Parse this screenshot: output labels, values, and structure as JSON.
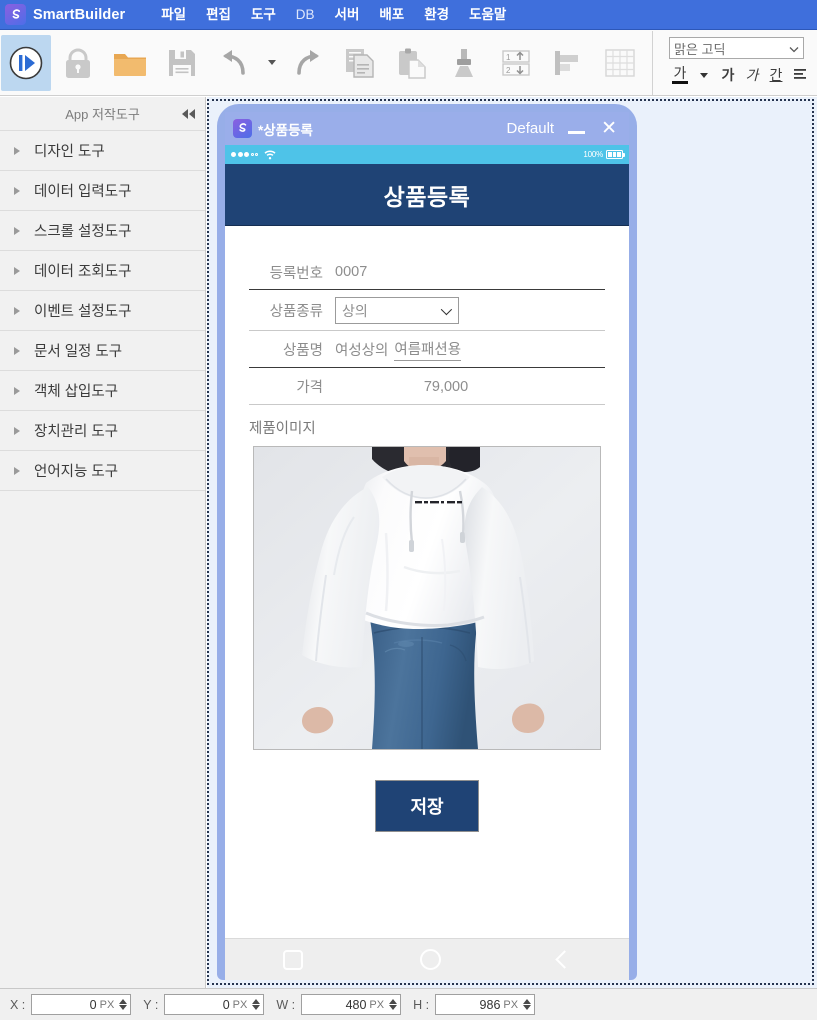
{
  "app": {
    "brand": "SmartBuilder",
    "logo_icon": "smartbuilder-s-logo-icon",
    "accent_color": "#3f6fdc",
    "canvas_color": "#eaf1fb",
    "device_frame_color": "#97aee8"
  },
  "menubar": {
    "items": [
      {
        "label": "파일",
        "name": "menu-file"
      },
      {
        "label": "편집",
        "name": "menu-edit"
      },
      {
        "label": "도구",
        "name": "menu-tools"
      },
      {
        "label": "DB",
        "name": "menu-db"
      },
      {
        "label": "서버",
        "name": "menu-server"
      },
      {
        "label": "배포",
        "name": "menu-deploy"
      },
      {
        "label": "환경",
        "name": "menu-environment"
      },
      {
        "label": "도움말",
        "name": "menu-help"
      }
    ]
  },
  "toolbar": {
    "buttons": [
      {
        "icon": "run-play-icon",
        "active": true
      },
      {
        "icon": "lock-icon",
        "active": false
      },
      {
        "icon": "open-folder-icon",
        "active": false
      },
      {
        "icon": "save-floppy-icon",
        "active": false
      },
      {
        "icon": "undo-arrow-icon",
        "active": false
      },
      {
        "icon": "undo-dropdown-caret-icon",
        "active": false
      },
      {
        "icon": "redo-arrow-icon",
        "active": false
      },
      {
        "icon": "copy-icon",
        "active": false
      },
      {
        "icon": "paste-icon",
        "active": false
      },
      {
        "icon": "format-brush-icon",
        "active": false
      },
      {
        "icon": "reorder-updown-icon",
        "active": false
      },
      {
        "icon": "align-left-icon",
        "active": false
      },
      {
        "icon": "grid-table-icon",
        "active": false
      }
    ],
    "font_family_value": "맑은 고딕",
    "font_dropdown_icon": "chevron-down-icon",
    "font_buttons": [
      {
        "icon": "font-color-icon",
        "label": "가"
      },
      {
        "icon": "font-color-caret-icon",
        "label": ""
      },
      {
        "icon": "bold-icon",
        "label": "가"
      },
      {
        "icon": "italic-icon",
        "label": "가"
      },
      {
        "icon": "underline-icon",
        "label": "간"
      },
      {
        "icon": "align-icon",
        "label": ""
      }
    ]
  },
  "sidebar": {
    "header_title": "App 저작도구",
    "collapse_icon": "collapse-left-double-arrow-icon",
    "items": [
      {
        "label": "디자인 도구",
        "name": "sidebar-item-design-tools"
      },
      {
        "label": "데이터 입력도구",
        "name": "sidebar-item-data-input-tools"
      },
      {
        "label": "스크롤 설정도구",
        "name": "sidebar-item-scroll-setting-tools"
      },
      {
        "label": "데이터 조회도구",
        "name": "sidebar-item-data-query-tools"
      },
      {
        "label": "이벤트 설정도구",
        "name": "sidebar-item-event-setting-tools"
      },
      {
        "label": "문서 일정 도구",
        "name": "sidebar-item-document-schedule-tools"
      },
      {
        "label": "객체 삽입도구",
        "name": "sidebar-item-object-insert-tools"
      },
      {
        "label": "장치관리 도구",
        "name": "sidebar-item-device-management-tools"
      },
      {
        "label": "언어지능 도구",
        "name": "sidebar-item-language-intelligence-tools"
      }
    ]
  },
  "device_window": {
    "titlebar": {
      "app_icon": "smartbuilder-s-logo-icon",
      "title": "*상품등록",
      "layout_label": "Default",
      "minimize_icon": "minimize-icon",
      "close_icon": "close-icon"
    },
    "phone_status_bar": {
      "signal_icon": "signal-dots-icon",
      "wifi_icon": "wifi-icon",
      "battery_percent": "100%",
      "battery_icon": "battery-full-icon"
    },
    "screen_header": "상품등록",
    "form": {
      "fields": [
        {
          "name": "registration-number",
          "label": "등록번호",
          "value": "0007",
          "type": "text",
          "underline": "thick"
        },
        {
          "name": "product-category",
          "label": "상품종류",
          "value": "상의",
          "type": "select",
          "dropdown_icon": "chevron-down-icon",
          "underline": "thin"
        },
        {
          "name": "product-name",
          "label": "상품명",
          "value_plain": "여성상의",
          "value_marked": "여름패션용",
          "type": "text",
          "underline": "thick"
        },
        {
          "name": "price",
          "label": "가격",
          "value": "79,000",
          "type": "text",
          "underline": "thin"
        }
      ],
      "image_label": "제품이미지",
      "image_alt": "white-cropped-hoodie-with-blue-jeans-product-photo",
      "save_button_label": "저장"
    },
    "android_nav": {
      "recent_icon": "square-recents-icon",
      "home_icon": "circle-home-icon",
      "back_icon": "chevron-left-back-icon"
    }
  },
  "bottom_status": {
    "fields": [
      {
        "name": "x-position",
        "label": "X :",
        "value": "0",
        "unit": "PX"
      },
      {
        "name": "y-position",
        "label": "Y :",
        "value": "0",
        "unit": "PX"
      },
      {
        "name": "width",
        "label": "W :",
        "value": "480",
        "unit": "PX"
      },
      {
        "name": "height",
        "label": "H :",
        "value": "986",
        "unit": "PX"
      }
    ],
    "stepper_icon": "stepper-updown-icon"
  }
}
